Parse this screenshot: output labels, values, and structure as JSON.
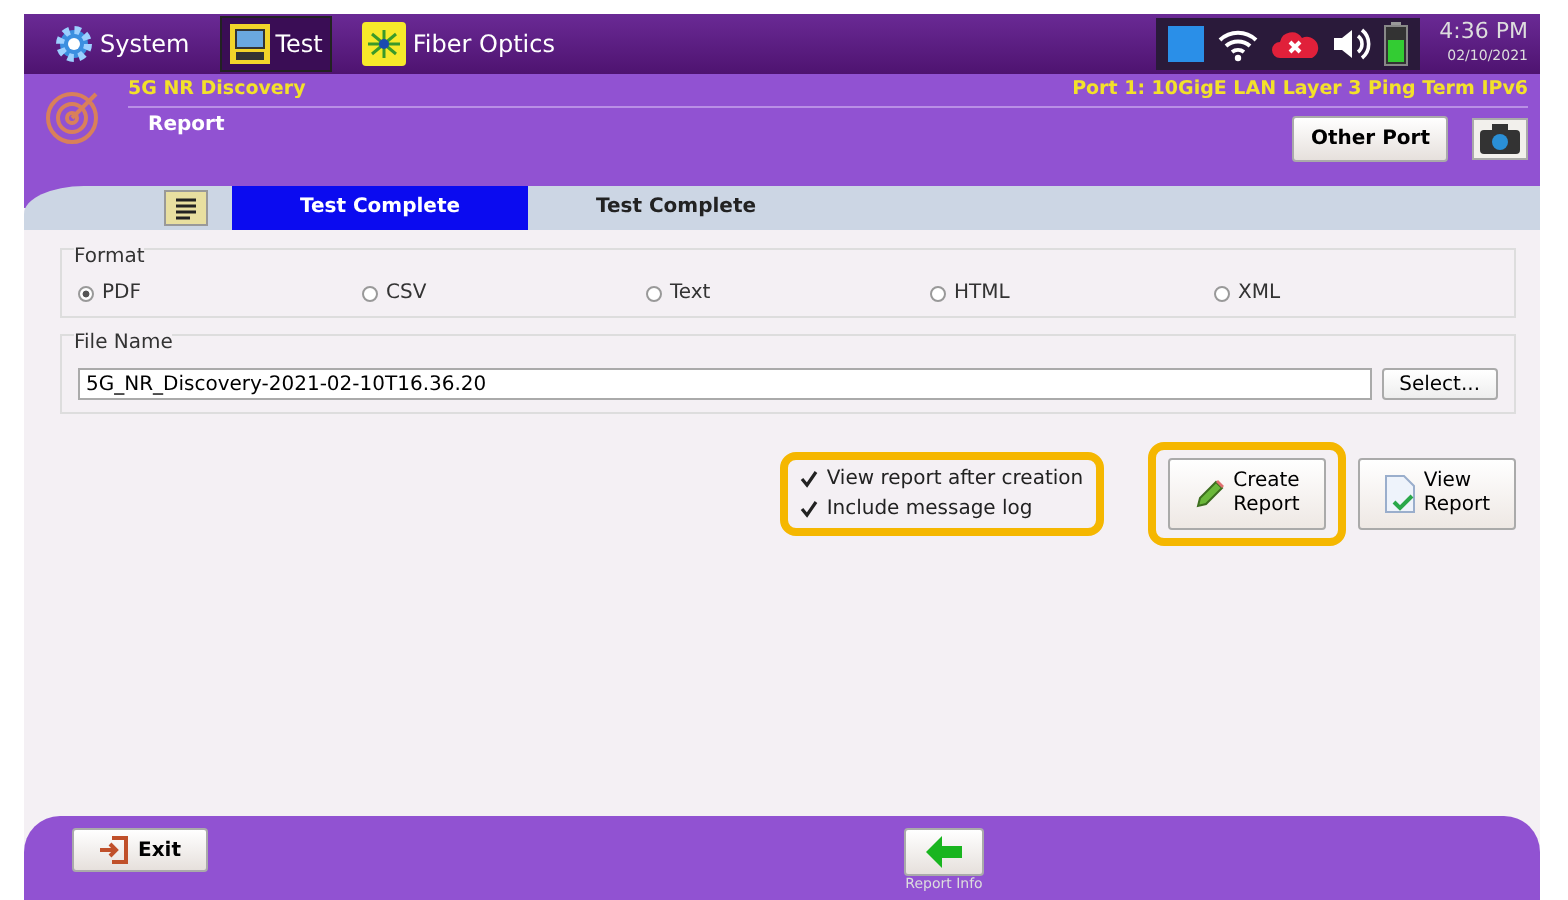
{
  "top_bar": {
    "tabs": [
      {
        "label": "System",
        "selected": false,
        "kind": "gear"
      },
      {
        "label": "Test",
        "selected": true,
        "kind": "bert"
      },
      {
        "label": "Fiber Optics",
        "selected": false,
        "kind": "fiber"
      }
    ],
    "time": "4:36 PM",
    "date": "02/10/2021"
  },
  "header": {
    "test_name": "5G NR Discovery",
    "port": "Port 1: 10GigE LAN Layer 3 Ping Term IPv6",
    "page": "Report",
    "other_port_button": "Other Port"
  },
  "status_tabs": [
    {
      "label": "Test Complete",
      "selected": true
    },
    {
      "label": "Test Complete",
      "selected": false
    }
  ],
  "format": {
    "label": "Format",
    "options": [
      {
        "label": "PDF",
        "selected": true
      },
      {
        "label": "CSV",
        "selected": false
      },
      {
        "label": "Text",
        "selected": false
      },
      {
        "label": "HTML",
        "selected": false
      },
      {
        "label": "XML",
        "selected": false
      }
    ]
  },
  "file_name": {
    "label": "File Name",
    "value": "5G_NR_Discovery-2021-02-10T16.36.20",
    "button": "Select..."
  },
  "options": [
    {
      "label": "View report after creation",
      "checked": true
    },
    {
      "label": "Include message log",
      "checked": true
    }
  ],
  "actions": [
    {
      "label": "Create\nReport",
      "kind": "create"
    },
    {
      "label": "View\nReport",
      "kind": "view"
    }
  ],
  "bottom_bar": {
    "exit_button": "Exit",
    "report_info": "Report Info"
  }
}
